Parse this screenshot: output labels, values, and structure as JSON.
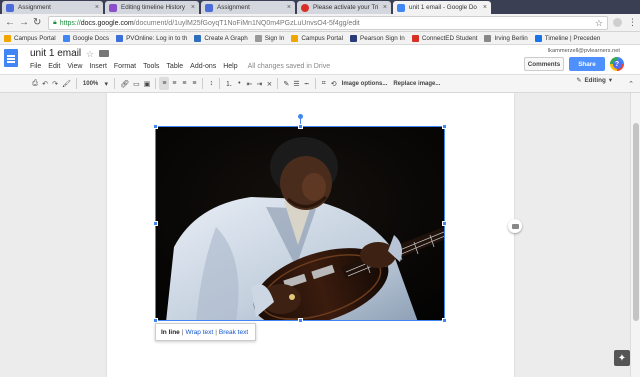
{
  "browser": {
    "tabs": [
      {
        "label": "Assignment",
        "fav": "#4a6cd8"
      },
      {
        "label": "Editing timeline History",
        "fav": "#8a4fc9"
      },
      {
        "label": "Assignment",
        "fav": "#4a6cd8"
      },
      {
        "label": "Please activate your Tri",
        "fav": "#d93025"
      },
      {
        "label": "unit 1 email - Google Do",
        "fav": "#4285f4"
      }
    ],
    "tab_close_glyph": "×",
    "url_https": "https://",
    "url_domain": "docs.google.com",
    "url_path": "/document/d/1uylM25fGoyqT1NoFiMn1NQ0m4PGzLuUnvsO4-5f4gg/edit"
  },
  "bookmarks": [
    {
      "label": "Campus Portal",
      "color": "#f0a500"
    },
    {
      "label": "Google Docs",
      "color": "#4285f4"
    },
    {
      "label": "PVOnline: Log in to th",
      "color": "#3b6fd9"
    },
    {
      "label": "Create A Graph",
      "color": "#2f6fbd"
    },
    {
      "label": "Sign In",
      "color": "#999999"
    },
    {
      "label": "Campus Portal",
      "color": "#f0a500"
    },
    {
      "label": "Pearson Sign In",
      "color": "#2a3b7a"
    },
    {
      "label": "ConnectED Student",
      "color": "#d93025"
    },
    {
      "label": "Irving Berlin",
      "color": "#888888"
    },
    {
      "label": "Timeline | Preceden",
      "color": "#1a73e8"
    }
  ],
  "doc": {
    "title": "unit 1 email",
    "menu": [
      "File",
      "Edit",
      "View",
      "Insert",
      "Format",
      "Tools",
      "Table",
      "Add-ons",
      "Help"
    ],
    "saved_status": "All changes saved in Drive",
    "user_email": "lkammerzell@pvlearners.net",
    "comments_label": "Comments",
    "share_label": "Share",
    "avatar_initial": "?"
  },
  "toolbar": {
    "zoom": "100%",
    "image_options": "Image options...",
    "replace_image": "Replace image...",
    "mode": "Editing"
  },
  "image_wrap": {
    "inline": "In line",
    "wrap": "Wrap text",
    "break": "Break text",
    "separator": "|"
  },
  "colors": {
    "accent_blue": "#4285f4",
    "share_blue": "#4d90fe",
    "chrome_dark": "#3b3f54"
  }
}
